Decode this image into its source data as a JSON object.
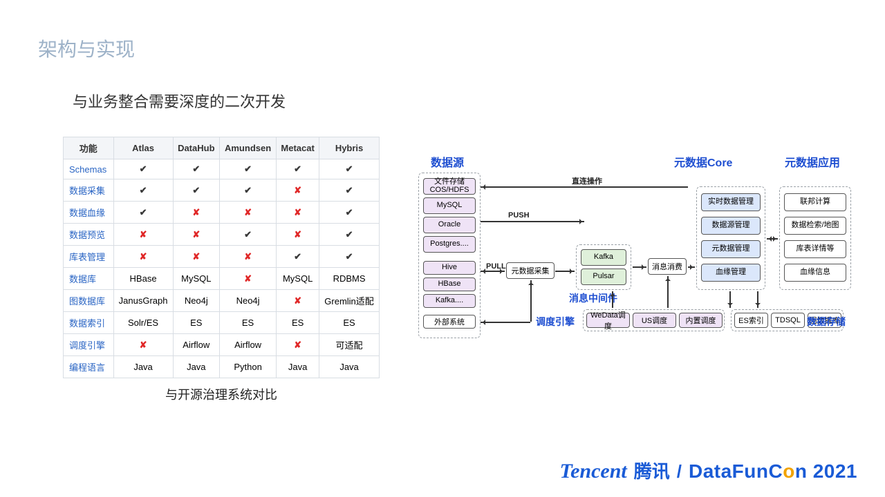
{
  "title": "架构与实现",
  "subtitle": "与业务整合需要深度的二次开发",
  "table": {
    "caption": "与开源治理系统对比",
    "headers": [
      "功能",
      "Atlas",
      "DataHub",
      "Amundsen",
      "Metacat",
      "Hybris"
    ],
    "rows": [
      {
        "k": "Schemas",
        "v": [
          "✓",
          "✓",
          "✓",
          "✓",
          "✓"
        ]
      },
      {
        "k": "数据采集",
        "v": [
          "✓",
          "✓",
          "✓",
          "✗",
          "✓"
        ]
      },
      {
        "k": "数据血缘",
        "v": [
          "✓",
          "✗",
          "✗",
          "✗",
          "✓"
        ]
      },
      {
        "k": "数据预览",
        "v": [
          "✗",
          "✗",
          "✓",
          "✗",
          "✓"
        ]
      },
      {
        "k": "库表管理",
        "v": [
          "✗",
          "✗",
          "✗",
          "✓",
          "✓"
        ]
      },
      {
        "k": "数据库",
        "v": [
          "HBase",
          "MySQL",
          "✗",
          "MySQL",
          "RDBMS"
        ]
      },
      {
        "k": "图数据库",
        "v": [
          "JanusGraph",
          "Neo4j",
          "Neo4j",
          "✗",
          "Gremlin适配"
        ]
      },
      {
        "k": "数据索引",
        "v": [
          "Solr/ES",
          "ES",
          "ES",
          "ES",
          "ES"
        ]
      },
      {
        "k": "调度引擎",
        "v": [
          "✗",
          "Airflow",
          "Airflow",
          "✗",
          "可适配"
        ]
      },
      {
        "k": "编程语言",
        "v": [
          "Java",
          "Java",
          "Python",
          "Java",
          "Java"
        ]
      }
    ]
  },
  "diagram": {
    "sections": {
      "source": "数据源",
      "mq": "消息中间件",
      "sched": "调度引擎",
      "core": "元数据Core",
      "app": "元数据应用",
      "storage": "数据存储"
    },
    "labels": {
      "direct": "直连操作",
      "push": "PUSH",
      "pull": "PULL"
    },
    "source_group1": [
      "文件存储\nCOS/HDFS",
      "MySQL",
      "Oracle",
      "Postgres...."
    ],
    "source_group2": [
      "Hive",
      "HBase",
      "Kafka...."
    ],
    "source_ext": "外部系统",
    "collector": "元数据采集",
    "mq_items": [
      "Kafka",
      "Pulsar"
    ],
    "consumer": "消息消费",
    "core_items": [
      "实时数据管理",
      "数据源管理",
      "元数据管理",
      "血缘管理"
    ],
    "app_items": [
      "联邦计算",
      "数据检索/地图",
      "库表详情等",
      "血缘信息"
    ],
    "sched_items": [
      "WeData调度",
      "US调度",
      "内置调度"
    ],
    "storage_items": [
      "ES索引",
      "TDSQL",
      "图数据库"
    ]
  },
  "footer": {
    "tencent_en": "Tencent",
    "tencent_cn": "腾讯",
    "sep": "/",
    "conf_a": "DataFunC",
    "conf_b": "n 2021"
  }
}
